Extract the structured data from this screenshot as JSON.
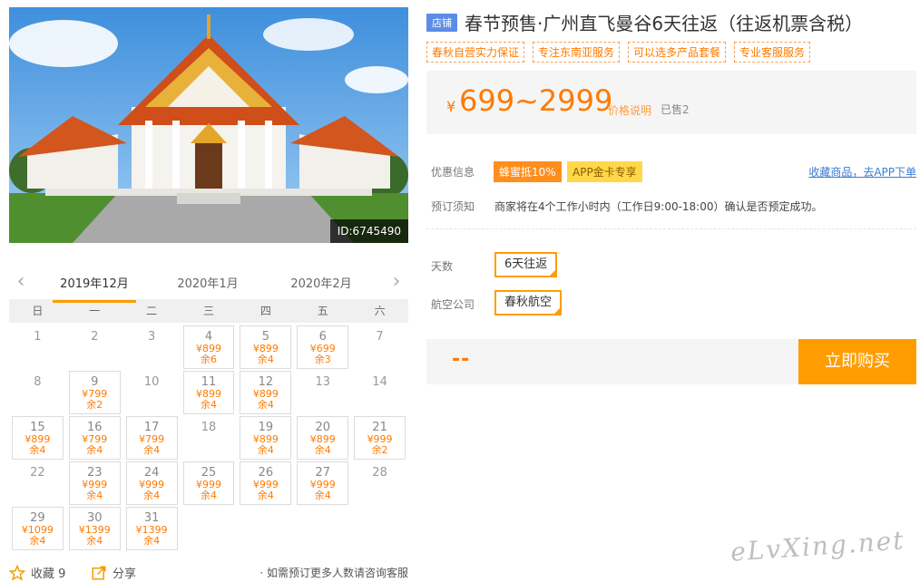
{
  "hero": {
    "id_label": "ID:6745490"
  },
  "calendar": {
    "months": [
      "2019年12月",
      "2020年1月",
      "2020年2月"
    ],
    "active_month": 0,
    "weekdays": [
      "日",
      "一",
      "二",
      "三",
      "四",
      "五",
      "六"
    ],
    "leading_blanks": 0,
    "days": [
      {
        "d": "1"
      },
      {
        "d": "2"
      },
      {
        "d": "3"
      },
      {
        "d": "4",
        "p": "¥899",
        "s": "余6"
      },
      {
        "d": "5",
        "p": "¥899",
        "s": "余4"
      },
      {
        "d": "6",
        "p": "¥699",
        "s": "余3"
      },
      {
        "d": "7"
      },
      {
        "d": "8"
      },
      {
        "d": "9",
        "p": "¥799",
        "s": "余2"
      },
      {
        "d": "10"
      },
      {
        "d": "11",
        "p": "¥899",
        "s": "余4"
      },
      {
        "d": "12",
        "p": "¥899",
        "s": "余4"
      },
      {
        "d": "13"
      },
      {
        "d": "14"
      },
      {
        "d": "15",
        "p": "¥899",
        "s": "余4"
      },
      {
        "d": "16",
        "p": "¥799",
        "s": "余4"
      },
      {
        "d": "17",
        "p": "¥799",
        "s": "余4"
      },
      {
        "d": "18"
      },
      {
        "d": "19",
        "p": "¥899",
        "s": "余4"
      },
      {
        "d": "20",
        "p": "¥899",
        "s": "余4"
      },
      {
        "d": "21",
        "p": "¥999",
        "s": "余2"
      },
      {
        "d": "22"
      },
      {
        "d": "23",
        "p": "¥999",
        "s": "余4"
      },
      {
        "d": "24",
        "p": "¥999",
        "s": "余4"
      },
      {
        "d": "25",
        "p": "¥999",
        "s": "余4"
      },
      {
        "d": "26",
        "p": "¥999",
        "s": "余4"
      },
      {
        "d": "27",
        "p": "¥999",
        "s": "余4"
      },
      {
        "d": "28"
      },
      {
        "d": "29",
        "p": "¥1099",
        "s": "余4"
      },
      {
        "d": "30",
        "p": "¥1399",
        "s": "余4"
      },
      {
        "d": "31",
        "p": "¥1399",
        "s": "余4"
      }
    ]
  },
  "bottom": {
    "fav_label": "收藏 9",
    "share_label": "分享",
    "note": "· 如需预订更多人数请咨询客服"
  },
  "product": {
    "shop_badge": "店铺",
    "title": "春节预售·广州直飞曼谷6天往返（往返机票含税）",
    "tags": [
      "春秋自营实力保证",
      "专注东南亚服务",
      "可以选多产品套餐",
      "专业客服服务"
    ],
    "currency": "¥",
    "price_range": "699~2999",
    "price_explain": "价格说明",
    "sold": "已售2",
    "promo_label": "优惠信息",
    "promos": [
      "蜂蜜抵10%",
      "APP金卡专享"
    ],
    "fav_app_link": "收藏商品，去APP下单",
    "notice_label": "预订须知",
    "notice": "商家将在4个工作小时内（工作日9:00-18:00）确认是否预定成功。",
    "days_label": "天数",
    "days_value": "6天往返",
    "airline_label": "航空公司",
    "airline_value": "春秋航空",
    "buy_placeholder": "--",
    "buy_label": "立即购买"
  },
  "watermark": "eLvXing.net",
  "colors": {
    "accent": "#ff9d00",
    "price": "#ff7a00",
    "link": "#3a7bd5",
    "badge": "#5b8de6"
  }
}
